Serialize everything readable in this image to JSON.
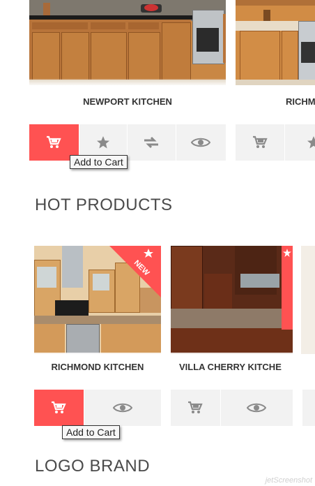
{
  "products_top": [
    {
      "name": "NEWPORT KITCHEN"
    },
    {
      "name": "RICHM"
    }
  ],
  "tooltip": {
    "add_to_cart": "Add to Cart"
  },
  "sections": {
    "hot_products": "HOT PRODUCTS",
    "logo_brand": "LOGO BRAND"
  },
  "products_hot": [
    {
      "name": "RICHMOND KITCHEN",
      "badge": "NEW"
    },
    {
      "name": "VILLA CHERRY KITCHE"
    }
  ],
  "watermark": "jetScreenshot",
  "colors": {
    "accent": "#ff5252",
    "button_bg": "#f2f2f2",
    "icon": "#8a8a8a"
  },
  "icons": [
    "cart-icon",
    "star-icon",
    "compare-icon",
    "eye-icon"
  ]
}
